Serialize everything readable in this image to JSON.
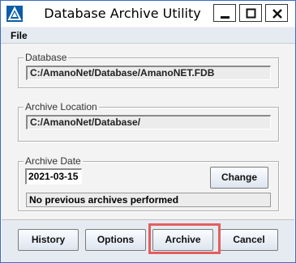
{
  "window": {
    "title": "Database Archive Utility",
    "icons": {
      "app": "app-icon",
      "minimize": "minimize-icon",
      "maximize": "maximize-icon",
      "close": "close-icon"
    }
  },
  "menu": {
    "file": "File"
  },
  "database": {
    "label": "Database",
    "value": "C:/AmanoNet/Database/AmanoNET.FDB"
  },
  "archive_location": {
    "label": "Archive Location",
    "value": "C:/AmanoNet/Database/"
  },
  "archive_date": {
    "label": "Archive Date",
    "value": "2021-03-15",
    "change_label": "Change",
    "status": "No previous archives performed"
  },
  "buttons": {
    "history": "History",
    "options": "Options",
    "archive": "Archive",
    "cancel": "Cancel"
  },
  "colors": {
    "accent": "#0a5da8",
    "highlight": "#e35f5f"
  }
}
